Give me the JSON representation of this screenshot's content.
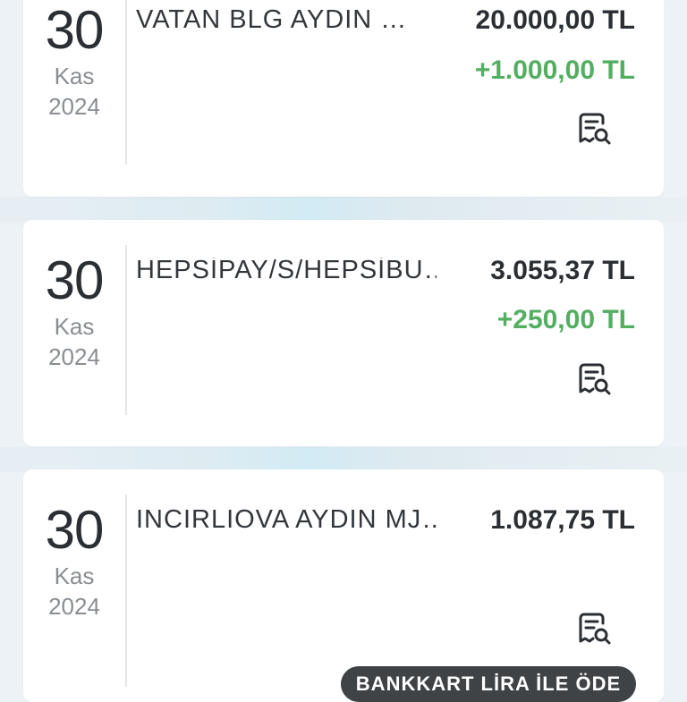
{
  "transactions": [
    {
      "day": "30",
      "month": "Kas",
      "year": "2024",
      "merchant": "VATAN BLG AYDIN  …",
      "amount": "20.000,00 TL",
      "bonus": "+1.000,00 TL",
      "icon": "receipt-search-icon"
    },
    {
      "day": "30",
      "month": "Kas",
      "year": "2024",
      "merchant": "HEPSİPAY/S/HEPSİBU…",
      "amount": "3.055,37 TL",
      "bonus": "+250,00 TL",
      "icon": "receipt-search-icon"
    },
    {
      "day": "30",
      "month": "Kas",
      "year": "2024",
      "merchant": "INCIRLIOVA AYDIN MJ…",
      "amount": "1.087,75 TL",
      "icon": "receipt-search-icon",
      "pay_button": "BANKKART LİRA İLE ÖDE"
    }
  ],
  "colors": {
    "background": "#edf2f6",
    "card": "#ffffff",
    "bonus_green": "#54ae62",
    "button_dark": "#3f4346"
  }
}
